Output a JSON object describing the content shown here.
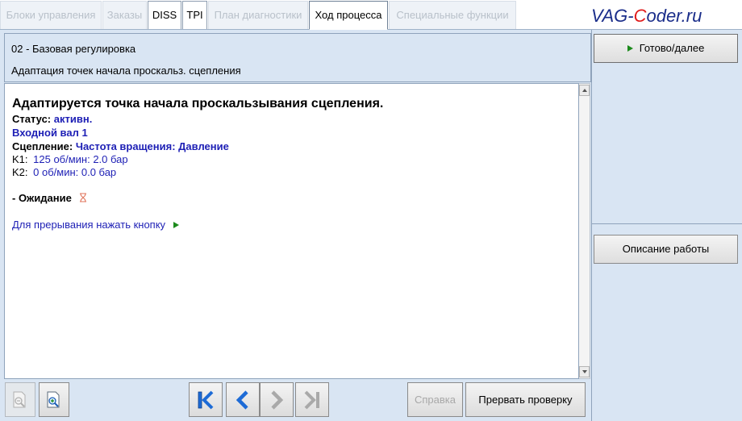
{
  "tabs": [
    {
      "label": "Блоки управления",
      "state": "disabled"
    },
    {
      "label": "Заказы",
      "state": "disabled"
    },
    {
      "label": "DISS",
      "state": "enabled"
    },
    {
      "label": "TPI",
      "state": "enabled"
    },
    {
      "label": "План диагностики",
      "state": "disabled"
    },
    {
      "label": "Ход процесса",
      "state": "active"
    },
    {
      "label": "Специальные функции",
      "state": "disabled"
    }
  ],
  "logo": {
    "prefix": "VAG-",
    "accent": "C",
    "suffix": "oder.ru"
  },
  "header": {
    "line1": "02 - Базовая регулировка",
    "line2": "Адаптация точек начала проскальз. сцепления"
  },
  "content": {
    "title": "Адаптируется точка начала проскальзывания сцепления.",
    "status_label": "Статус:",
    "status_value": "активн.",
    "input_shaft": "Входной вал 1",
    "clutch_label": "Сцепление:",
    "clutch_value": "Частота вращения: Давление",
    "k1_label": "K1:",
    "k1_value": "125  об/мин: 2.0  бар",
    "k2_label": "K2:",
    "k2_value": "0  об/мин: 0.0  бар",
    "waiting": "- Ожидание",
    "interrupt_hint": "Для прерывания нажать кнопку"
  },
  "right_panel": {
    "ready_button": "Готово/далее",
    "description_button": "Описание работы"
  },
  "bottom_bar": {
    "help_button": "Справка",
    "abort_button": "Прервать проверку"
  },
  "colors": {
    "accent_blue": "#1d1fb5",
    "green_arrow": "#1c8a1c",
    "panel_bg": "#d9e5f3",
    "logo_blue": "#1a2d8a",
    "logo_red": "#e01b1b",
    "hourglass": "#e0735a"
  },
  "icons": {
    "zoom_out": "zoom-out-icon",
    "zoom_in": "zoom-in-icon",
    "first": "skip-first-icon",
    "prev": "chevron-left-icon",
    "next": "chevron-right-icon",
    "last": "skip-last-icon",
    "hourglass": "hourglass-icon",
    "play": "play-arrow-icon"
  }
}
